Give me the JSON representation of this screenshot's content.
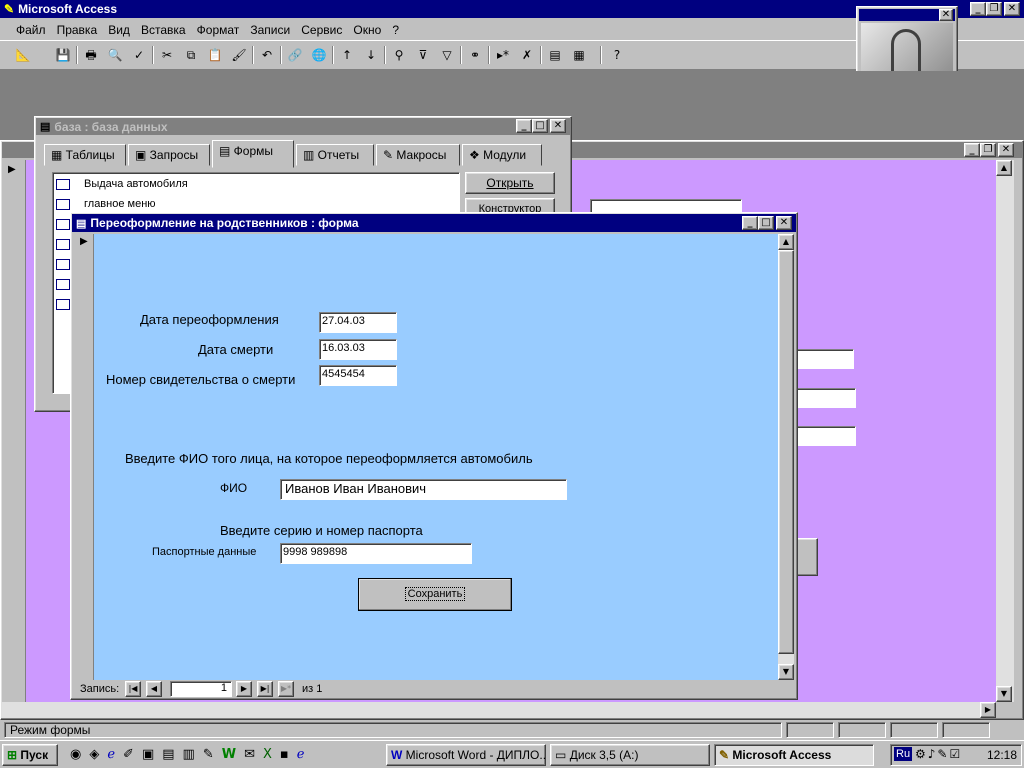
{
  "app": {
    "title": "Microsoft Access"
  },
  "menu": [
    "Файл",
    "Правка",
    "Вид",
    "Вставка",
    "Формат",
    "Записи",
    "Сервис",
    "Окно",
    "?"
  ],
  "db_window": {
    "title": "база : база данных",
    "tabs": [
      "Таблицы",
      "Запросы",
      "Формы",
      "Отчеты",
      "Макросы",
      "Модули"
    ],
    "active_tab": "Формы",
    "items": [
      "Выдача автомобиля",
      "главное меню"
    ],
    "buttons": [
      "Открыть",
      "Конструктор"
    ]
  },
  "form": {
    "title": "Переоформление на родственников : форма",
    "fields": [
      {
        "label": "Дата переоформления",
        "value": "27.04.03"
      },
      {
        "label": "Дата смерти",
        "value": "16.03.03"
      },
      {
        "label": "Номер свидетельства о смерти",
        "value": "4545454"
      }
    ],
    "prompt_fio": "Введите ФИО того лица, на которое переоформляется автомобиль",
    "fio_label": "ФИО",
    "fio_value": "Иванов Иван Иванович",
    "prompt_passport": "Введите серию и номер паспорта",
    "passport_label": "Паспортные данные",
    "passport_value": "9998 989898",
    "save_label": "Сохранить",
    "nav": {
      "label": "Запись:",
      "current": "1",
      "of": "из",
      "total": "1"
    }
  },
  "status_bar": {
    "text": "Режим формы"
  },
  "taskbar": {
    "start": "Пуск",
    "tasks": [
      "Microsoft Word - ДИПЛО...",
      "Диск 3,5 (A:)",
      "Microsoft Access"
    ],
    "lang": "Ru",
    "clock": "12:18"
  },
  "colors": {
    "titlebar": "#000080",
    "form_bg": "#99ccff",
    "background_form": "#cc99ff",
    "desktop": "#808080"
  }
}
